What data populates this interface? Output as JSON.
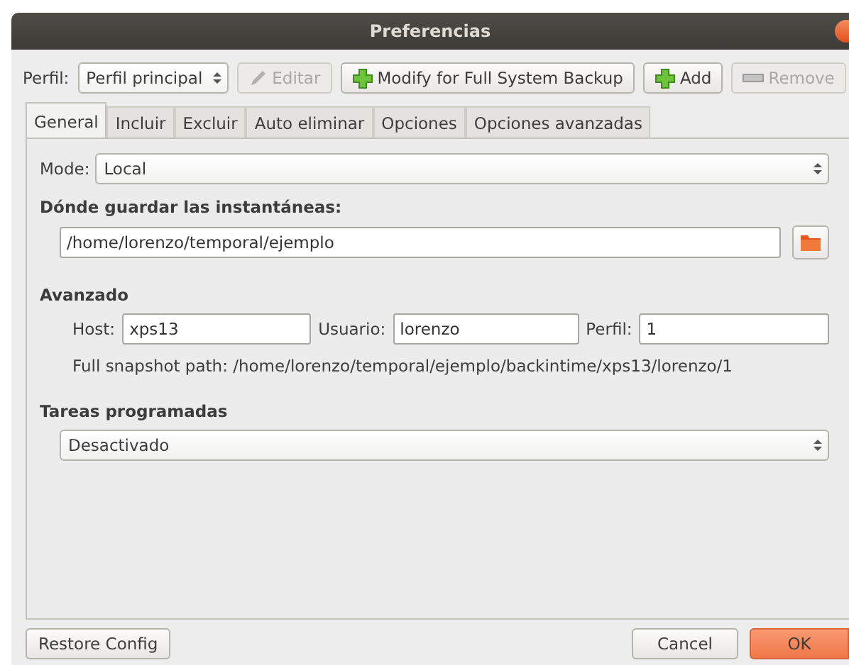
{
  "window": {
    "title": "Preferencias"
  },
  "toolbar": {
    "profile_label": "Perfil:",
    "profile_value": "Perfil principal",
    "buttons": [
      {
        "label": "Editar",
        "kind": "edit",
        "disabled": true
      },
      {
        "label": "Modify for Full System Backup",
        "kind": "add",
        "disabled": false
      },
      {
        "label": "Add",
        "kind": "add",
        "disabled": false
      },
      {
        "label": "Remove",
        "kind": "remove",
        "disabled": true
      }
    ]
  },
  "tabs": [
    {
      "label": "General",
      "selected": true
    },
    {
      "label": "Incluir",
      "selected": false
    },
    {
      "label": "Excluir",
      "selected": false
    },
    {
      "label": "Auto eliminar",
      "selected": false
    },
    {
      "label": "Opciones",
      "selected": false
    },
    {
      "label": "Opciones avanzadas",
      "selected": false
    }
  ],
  "general": {
    "mode_label": "Mode:",
    "mode_value": "Local",
    "location_heading": "Dónde guardar las instantáneas:",
    "location_path": "/home/lorenzo/temporal/ejemplo",
    "advanced_heading": "Avanzado",
    "host_label": "Host:",
    "host_value": "xps13",
    "user_label": "Usuario:",
    "user_value": "lorenzo",
    "profile_label": "Perfil:",
    "profile_value": "1",
    "full_path": "Full snapshot path: /home/lorenzo/temporal/ejemplo/backintime/xps13/lorenzo/1",
    "schedule_heading": "Tareas programadas",
    "schedule_value": "Desactivado"
  },
  "footer": {
    "left_buttons": [
      {
        "label": "Restore Config",
        "default": false
      }
    ],
    "right_buttons": [
      {
        "label": "Cancel",
        "default": false
      },
      {
        "label": "OK",
        "default": true
      }
    ]
  }
}
